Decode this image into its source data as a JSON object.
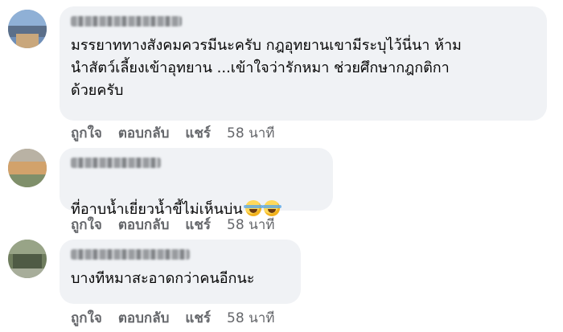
{
  "comments": [
    {
      "text": "มรรยาททางสังคมควรมีนะครับ กฎอุทยานเขามีระบุไว้นี่นา ห้าม\nนำสัตว์เลี้ยงเข้าอุทยาน ...เข้าใจว่ารักหมา ช่วยศึกษากฎกติกา\nด้วยครับ",
      "like": "ถูกใจ",
      "reply": "ตอบกลับ",
      "share": "แชร์",
      "time": "58 นาที"
    },
    {
      "text": "ที่อาบน้ำเยี่ยวน้ำขี้ไม่เห็นบ่น",
      "emoji_icon": "rolling-on-the-floor-laughing-icon",
      "like": "ถูกใจ",
      "reply": "ตอบกลับ",
      "share": "แชร์",
      "time": "58 นาที"
    },
    {
      "text": "บางทีหมาสะอาดกว่าคนอีกนะ",
      "like": "ถูกใจ",
      "reply": "ตอบกลับ",
      "share": "แชร์",
      "time": "58 นาที"
    }
  ],
  "colors": {
    "bubble": "#f0f2f5",
    "action_text": "#65676b",
    "body_text": "#050505"
  }
}
